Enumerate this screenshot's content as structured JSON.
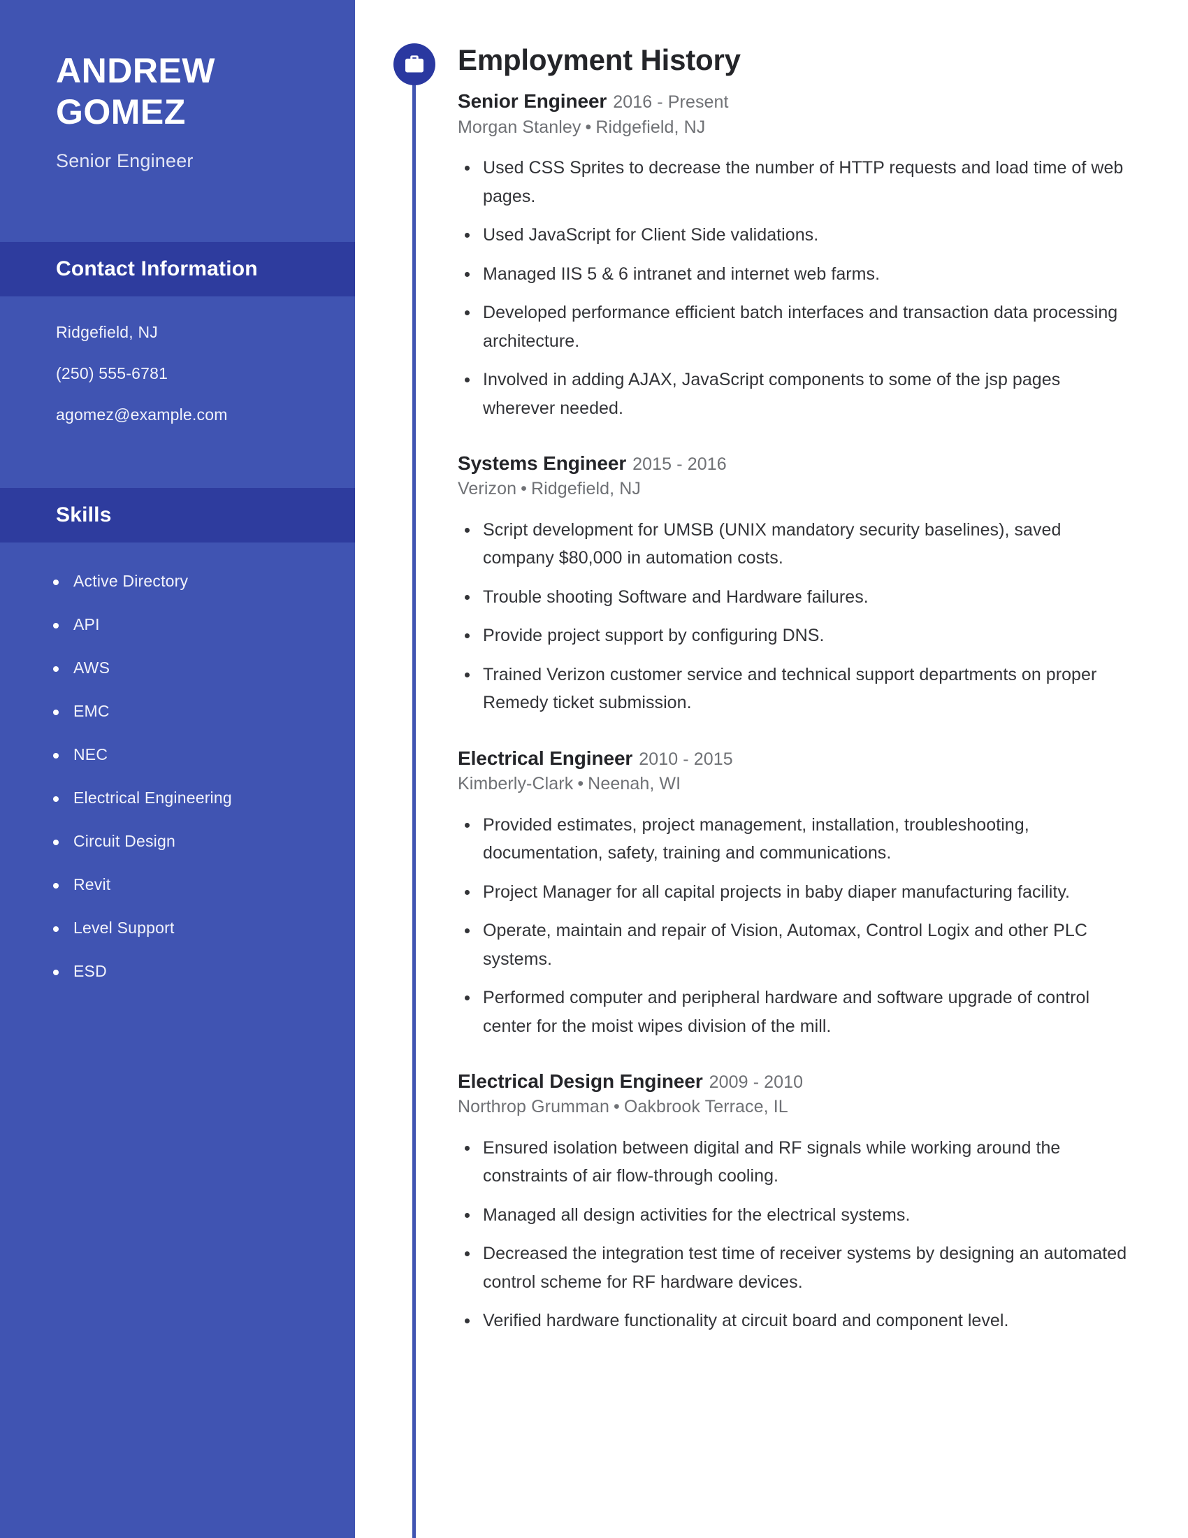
{
  "theme": {
    "sidebar_bg": "#4054b2",
    "sidebar_band_bg": "#2e3c9e",
    "accent": "#2a38a0",
    "page_bg": "#ffffff",
    "heading_color": "#242529",
    "muted_color": "#6f7175"
  },
  "sidebar": {
    "name": "ANDREW GOMEZ",
    "name_line1": "ANDREW",
    "name_line2": "GOMEZ",
    "subtitle": "Senior Engineer",
    "contact": {
      "heading": "Contact Information",
      "lines": [
        "Ridgefield, NJ",
        "(250) 555-6781",
        "agomez@example.com"
      ]
    },
    "skills": {
      "heading": "Skills",
      "items": [
        "Active Directory",
        "API",
        "AWS",
        "EMC",
        "NEC",
        "Electrical Engineering",
        "Circuit Design",
        "Revit",
        "Level Support",
        "ESD"
      ]
    }
  },
  "main": {
    "section_icon": "briefcase-icon",
    "title": "Employment History",
    "jobs": [
      {
        "title": "Senior Engineer",
        "dates": "2016 - Present",
        "company": "Morgan Stanley",
        "separator": "•",
        "location": "Ridgefield, NJ",
        "bullets": [
          "Used CSS Sprites to decrease the number of HTTP requests and load time of web pages.",
          "Used JavaScript for Client Side validations.",
          "Managed IIS 5 & 6 intranet and internet web farms.",
          "Developed performance efficient batch interfaces and transaction data processing architecture.",
          "Involved in adding AJAX, JavaScript components to some of the jsp pages wherever needed."
        ]
      },
      {
        "title": "Systems Engineer",
        "dates": "2015 - 2016",
        "company": "Verizon",
        "separator": "•",
        "location": "Ridgefield, NJ",
        "bullets": [
          "Script development for UMSB (UNIX mandatory security baselines), saved company $80,000 in automation costs.",
          "Trouble shooting Software and Hardware failures.",
          "Provide project support by configuring DNS.",
          "Trained Verizon customer service and technical support departments on proper Remedy ticket submission."
        ]
      },
      {
        "title": "Electrical Engineer",
        "dates": "2010 - 2015",
        "company": "Kimberly-Clark",
        "separator": "•",
        "location": "Neenah, WI",
        "bullets": [
          "Provided estimates, project management, installation, troubleshooting, documentation, safety, training and communications.",
          "Project Manager for all capital projects in baby diaper manufacturing facility.",
          "Operate, maintain and repair of Vision, Automax, Control Logix and other PLC systems.",
          "Performed computer and peripheral hardware and software upgrade of control center for the moist wipes division of the mill."
        ]
      },
      {
        "title": "Electrical Design Engineer",
        "dates": "2009 - 2010",
        "company": "Northrop Grumman",
        "separator": "•",
        "location": "Oakbrook Terrace, IL",
        "bullets": [
          "Ensured isolation between digital and RF signals while working around the constraints of air flow-through cooling.",
          "Managed all design activities for the electrical systems.",
          "Decreased the integration test time of receiver systems by designing an automated control scheme for RF hardware devices.",
          "Verified hardware functionality at circuit board and component level."
        ]
      }
    ]
  }
}
